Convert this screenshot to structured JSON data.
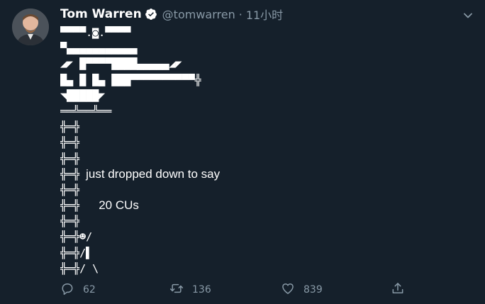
{
  "author": {
    "name": "Tom Warren",
    "handle": "@tomwarren",
    "separator": "·",
    "time": "11小时"
  },
  "body_lines": [
    "▀▀▀▀.◙.▀▀▀▀",
    "▀▄▄▄▄▄▄▄▄▄▄▄",
    "◢◤ █▀▀▀▀████▄▄▄▄▄◢◤",
    "█▄ █ █▄ ███▀▀▀▀▀▀▀▀▀▀╬",
    "◥█████◤",
    "══╩══╩══",
    "╬═╬",
    "╬═╬",
    "╬═╬",
    "╬═╬",
    "╬═╬",
    "╬═╬",
    "╬═╬",
    "╬═╬☻/",
    "╬═╬/▌",
    "╬═╬/ \\"
  ],
  "body_text": {
    "line9": "just dropped down to say",
    "line11": "20 CUs"
  },
  "actions": {
    "reply_count": "62",
    "retweet_count": "136",
    "like_count": "839"
  },
  "icons": {
    "verified": "verified-badge-icon",
    "caret": "chevron-down-icon",
    "reply": "reply-bubble-icon",
    "retweet": "retweet-icon",
    "like": "heart-icon",
    "share": "share-upload-icon"
  },
  "colors": {
    "background": "#15202b",
    "text": "#ffffff",
    "muted": "#8899a6"
  }
}
